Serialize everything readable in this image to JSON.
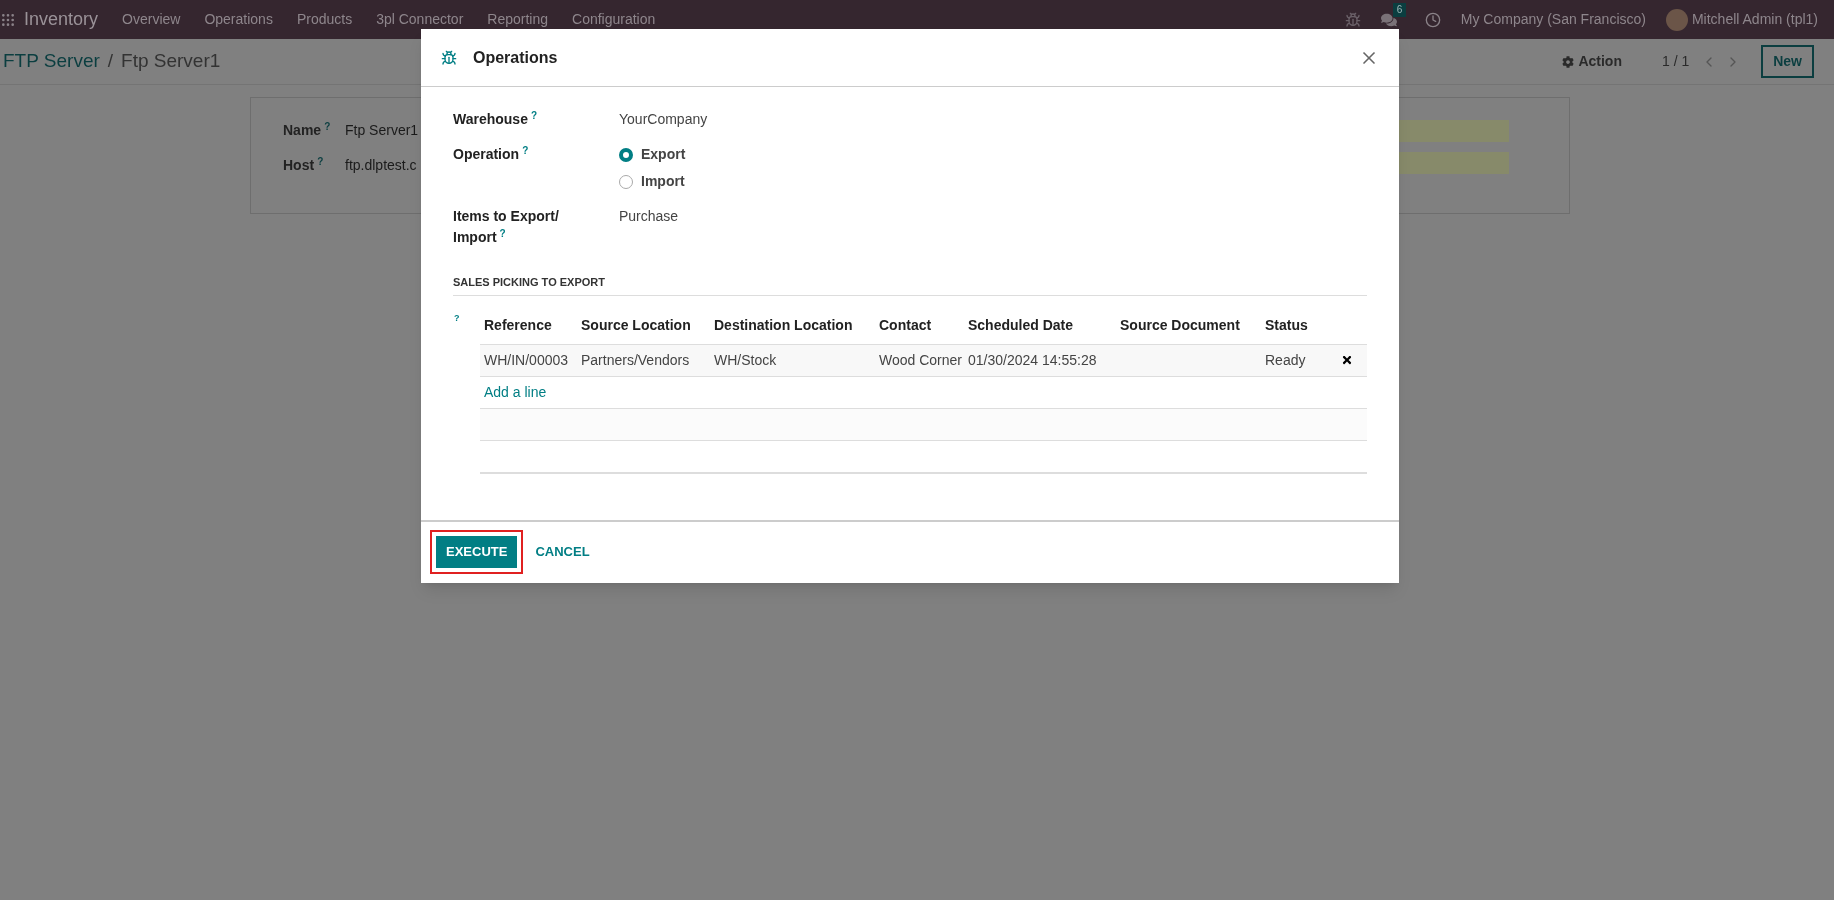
{
  "navbar": {
    "app": "Inventory",
    "menu": [
      "Overview",
      "Operations",
      "Products",
      "3pl Connector",
      "Reporting",
      "Configuration"
    ],
    "messages_count": "6",
    "company": "My Company (San Francisco)",
    "user": "Mitchell Admin (tpl1)"
  },
  "breadcrumb": {
    "parent": "FTP Server",
    "separator": "/",
    "current": "Ftp Server1"
  },
  "control_panel": {
    "action": "Action",
    "pager": "1 / 1",
    "new": "New"
  },
  "form": {
    "fields": [
      {
        "label": "Name",
        "help": "?",
        "value": "Ftp Server1"
      },
      {
        "label": "Host",
        "help": "?",
        "value": "ftp.dlptest.c"
      }
    ]
  },
  "dialog": {
    "title": "Operations",
    "fields": [
      {
        "kind": "text",
        "label": "Warehouse",
        "help": "?",
        "value": "YourCompany"
      },
      {
        "kind": "radio",
        "label": "Operation",
        "help": "?",
        "options": [
          {
            "label": "Export",
            "selected": true
          },
          {
            "label": "Import",
            "selected": false
          }
        ]
      },
      {
        "kind": "text",
        "label": "Items to Export/ Import",
        "help": "?",
        "value": "Purchase"
      }
    ],
    "section": "SALES PICKING TO EXPORT",
    "table_help": "?",
    "table": {
      "columns": [
        "Reference",
        "Source Location",
        "Destination Location",
        "Contact",
        "Scheduled Date",
        "Source Document",
        "Status"
      ],
      "rows": [
        [
          "WH/IN/00003",
          "Partners/Vendors",
          "WH/Stock",
          "Wood Corner",
          "01/30/2024 14:55:28",
          "",
          "Ready"
        ]
      ],
      "add_line": "Add a line"
    },
    "buttons": [
      {
        "label": "EXECUTE",
        "kind": "primary",
        "highlighted": true
      },
      {
        "label": "CANCEL",
        "kind": "link",
        "highlighted": false
      }
    ]
  }
}
